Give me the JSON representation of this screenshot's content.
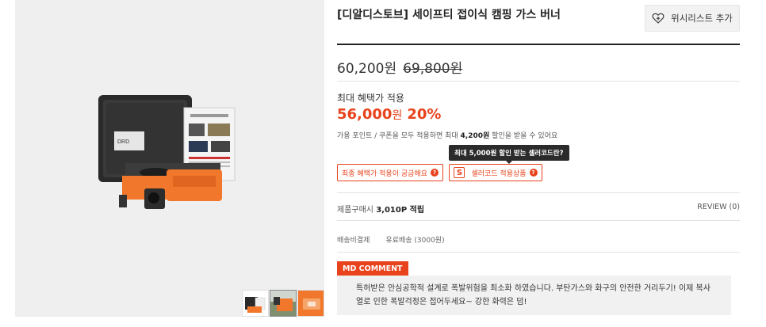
{
  "product": {
    "title": "[디알디스토브] 세이프티 접이식 캠핑 가스 버너",
    "wishlist_label": "위시리스트 추가",
    "sale_price": "60,200원",
    "original_price": "69,800원"
  },
  "benefit": {
    "label": "최대 혜택가 적용",
    "price_number": "56,000",
    "price_unit": "원",
    "percent": "20%",
    "note_prefix": "가용 포인트 / 쿠폰을 모두 적용하면 최대 ",
    "note_amount": "4,200원",
    "note_suffix": " 할인을 받을 수 있어요"
  },
  "tooltip": "최대 5,000원 할인 받는 셀러코드란?",
  "buttons": {
    "max_benefit": "최종 혜택가 적용이 궁금해요",
    "seller_code_badge": "S",
    "seller_code": "셀러코드 적용상품",
    "question_mark": "?"
  },
  "points": {
    "prefix": "제품구매시 ",
    "value": "3,010P 적립",
    "review": "REVIEW (0)"
  },
  "shipping": {
    "label": "배송비결제",
    "value": "유료배송 (3000원)"
  },
  "md_comment": {
    "badge": "MD COMMENT",
    "text": "특허받은 안심공학적 설계로 폭발위험을 최소화 하였습니다. 부탄가스와 화구의 안전한 거리두기! 이제 복사열로 인한 폭발걱정은 접어두세요~ 강한 화력은 덤!"
  },
  "colors": {
    "accent": "#e8431c",
    "product_orange": "#f0772b",
    "case_black": "#2a2a2a"
  },
  "icons": {
    "wishlist": "heart-plus-icon",
    "question": "question-circle-icon"
  }
}
